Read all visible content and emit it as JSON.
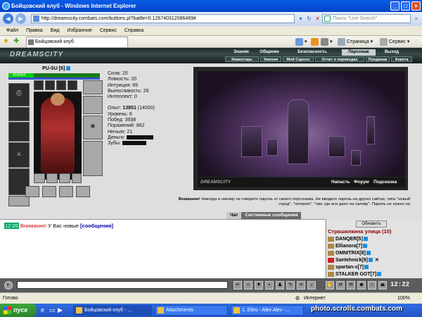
{
  "window": {
    "title": "Бойцовский клуб - Windows Internet Explorer"
  },
  "address": {
    "url": "http://dreamscity.combats.com/buttons.pl?battle=0.126740312086469#",
    "search_placeholder": "Поиск \"Live Search\""
  },
  "menu": [
    "Файл",
    "Правка",
    "Вид",
    "Избранное",
    "Сервис",
    "Справка"
  ],
  "tab": {
    "title": "Бойцовский клуб"
  },
  "toolbar": {
    "page_label": "Страница",
    "service_label": "Сервис"
  },
  "game": {
    "logo": "DREAMSCITY",
    "top_menu": [
      "Знания",
      "Общение",
      "Безопасность",
      "Персонаж",
      "Выход"
    ],
    "sub_menu": [
      "Инвентарь",
      "Умения",
      "Мой Скролл",
      "Отчет о переводах",
      "Поединки",
      "Анкета"
    ],
    "character": {
      "name": "PU-SU",
      "level": "[6]",
      "hp": "404/404"
    },
    "stats": {
      "strength": "Сила: 20",
      "agility": "Ловкость: 20",
      "intuition": "Интуиция: 69",
      "endurance": "Выносливость: 26",
      "intellect": "Интеллект: 0",
      "exp_label": "Опыт:",
      "exp_value": "13851",
      "exp_next": "(14000)",
      "level": "Уровень: 6",
      "wins": "Побед: 3938",
      "losses": "Поражений: 862",
      "draws": "Ничьих: 21",
      "money": "Деньги:",
      "teeth": "Зубы:"
    },
    "scene_bar": {
      "logo": "DREAMSCITY",
      "attack": "Напасть",
      "forum": "Форум",
      "hint": "Подсказка"
    },
    "warning": {
      "bold": "Внимание!",
      "text": "Никогда и никому не говорите пароль от своего персонажа. Не вводите пароль на других сайтах, типа \"новый город\", \"лотерея\", \"там, где все дают на халяву\". Пароль не нужен ни"
    },
    "chat_tabs": [
      "Чат",
      "Системные сообщения"
    ],
    "chat": {
      "time": "12:20",
      "warn": "Внимание!",
      "text": "У Вас новые",
      "link": "[сообщения]"
    },
    "street": {
      "refresh": "Обновить",
      "title": "Страшилкина улица (10)",
      "players": [
        {
          "name": "DANQER",
          "level": "[5]"
        },
        {
          "name": "Ellianora",
          "level": "[7]"
        },
        {
          "name": "OMNITRIX",
          "level": "[8]"
        },
        {
          "name": "Santehnick",
          "level": "[9]"
        },
        {
          "name": "spartan-x",
          "level": "[7]"
        },
        {
          "name": "STALKER GOT",
          "level": "[7]"
        }
      ]
    },
    "clock": "12:22"
  },
  "status": {
    "ready": "Готово",
    "zone": "Интернет",
    "zoom": "100%"
  },
  "taskbar": {
    "start": "пуск",
    "tasks": [
      "Бойцовский клуб - ...",
      "Attachments",
      "1. Ebru - Alev Alev -..."
    ],
    "watermark": "photo.scrolls.combats.com"
  },
  "colors": {
    "title_bar": "#0a5de6",
    "game_header": "#1a2a2a",
    "street_title": "#8a0000"
  }
}
